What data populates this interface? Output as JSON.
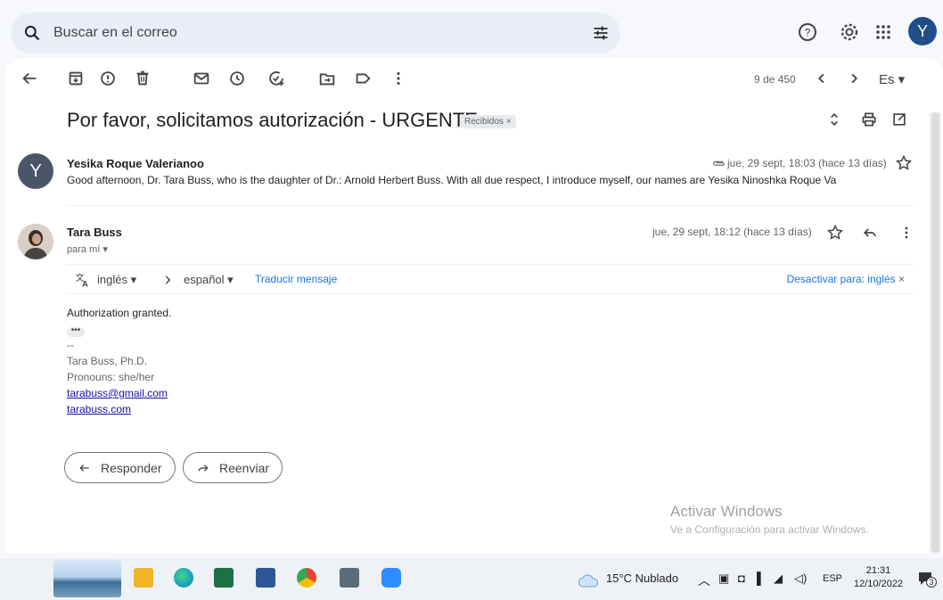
{
  "search": {
    "placeholder": "Buscar en el correo"
  },
  "topbar": {
    "avatar_letter": "Y"
  },
  "toolbar": {
    "counter": "9 de 450",
    "language": "Es ▾"
  },
  "thread": {
    "subject": "Por favor, solicitamos autorización - URGENTE",
    "label": "Recibidos ×"
  },
  "message1": {
    "avatar_letter": "Y",
    "sender": "Yesika Roque Valerianoo",
    "date": "jue, 29 sept, 18:03 (hace 13 días)",
    "snippet": "Good afternoon, Dr. Tara Buss, who is the daughter of Dr.: Arnold Herbert Buss. With all due respect, I introduce myself, our names are Yesika Ninoshka Roque Va"
  },
  "message2": {
    "sender": "Tara Buss",
    "to": "para mí ▾",
    "date": "jue, 29 sept, 18:12 (hace 13 días)",
    "translate": {
      "from": "inglés ▾",
      "to": "español ▾",
      "action": "Traducir mensaje",
      "disable": "Desactivar para: inglés"
    },
    "body": "Authorization granted.",
    "dots": "•••",
    "sig_dash": "--",
    "sig_name": "Tara Buss, Ph.D.",
    "sig_pronouns": "Pronouns: she/her",
    "sig_email": "tarabuss@gmail.com",
    "sig_site": "tarabuss.com"
  },
  "actions": {
    "reply": "Responder",
    "forward": "Reenviar"
  },
  "watermark": {
    "title": "Activar Windows",
    "subtitle": "Ve a Configuración para activar Windows."
  },
  "taskbar": {
    "weather": "15°C Nublado",
    "lang": "ESP",
    "time": "21:31",
    "date": "12/10/2022",
    "notif_count": "3"
  }
}
